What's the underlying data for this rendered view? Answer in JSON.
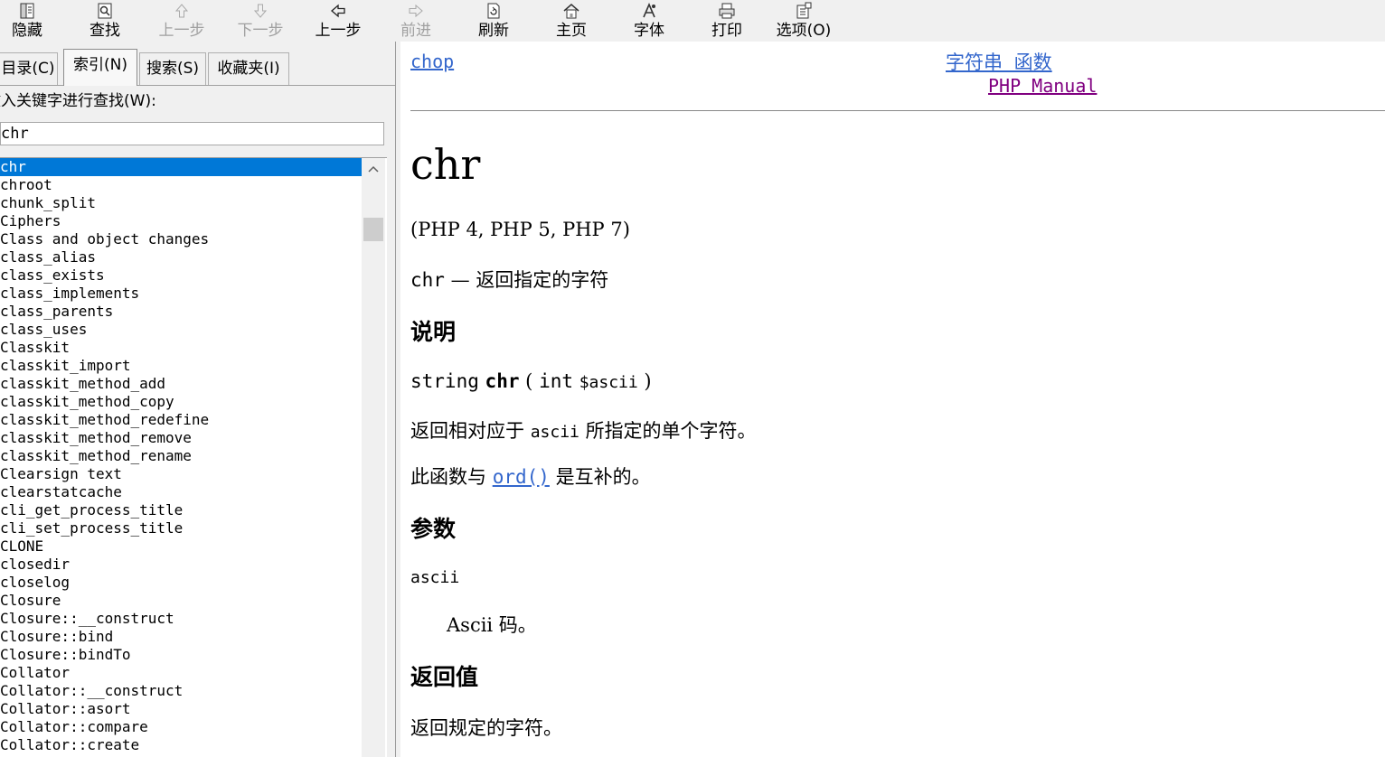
{
  "toolbar": {
    "hide": "隐藏",
    "find": "查找",
    "prev": "上一步",
    "next": "下一步",
    "back": "上一步",
    "forward": "前进",
    "refresh": "刷新",
    "home": "主页",
    "font": "字体",
    "print": "打印",
    "options": "选项(O)"
  },
  "tabs": [
    "目录(C)",
    "索引(N)",
    "搜索(S)",
    "收藏夹(I)"
  ],
  "keyword_label": "键入关键字进行查找(W):",
  "search_value": "chr",
  "index_items": [
    "chr",
    "chroot",
    "chunk_split",
    "Ciphers",
    "Class and object changes",
    "class_alias",
    "class_exists",
    "class_implements",
    "class_parents",
    "class_uses",
    "Classkit",
    "classkit_import",
    "classkit_method_add",
    "classkit_method_copy",
    "classkit_method_redefine",
    "classkit_method_remove",
    "classkit_method_rename",
    "Clearsign text",
    "clearstatcache",
    "cli_get_process_title",
    "cli_set_process_title",
    "CLONE",
    "closedir",
    "closelog",
    "Closure",
    "Closure::__construct",
    "Closure::bind",
    "Closure::bindTo",
    "Collator",
    "Collator::__construct",
    "Collator::asort",
    "Collator::compare",
    "Collator::create"
  ],
  "selected_index": 0,
  "content": {
    "prev_link": "chop",
    "up_link": "字符串 函数",
    "home_link": "PHP Manual",
    "title": "chr",
    "versions": "(PHP 4, PHP 5, PHP 7)",
    "refname": "chr",
    "dash": "—",
    "refpurpose": "返回指定的字符",
    "sec_description": "说明",
    "sig_type": "string",
    "sig_name": "chr",
    "sig_open": "(",
    "sig_param_type": "int",
    "sig_param_name": "$ascii",
    "sig_close": ")",
    "desc_before": "返回相对应于",
    "desc_code": "ascii",
    "desc_after": "所指定的单个字符。",
    "compl_before": "此函数与",
    "compl_link": "ord()",
    "compl_after": "是互补的。",
    "sec_params": "参数",
    "param_name": "ascii",
    "param_desc": "Ascii 码。",
    "sec_return": "返回值",
    "return_desc": "返回规定的字符。"
  }
}
